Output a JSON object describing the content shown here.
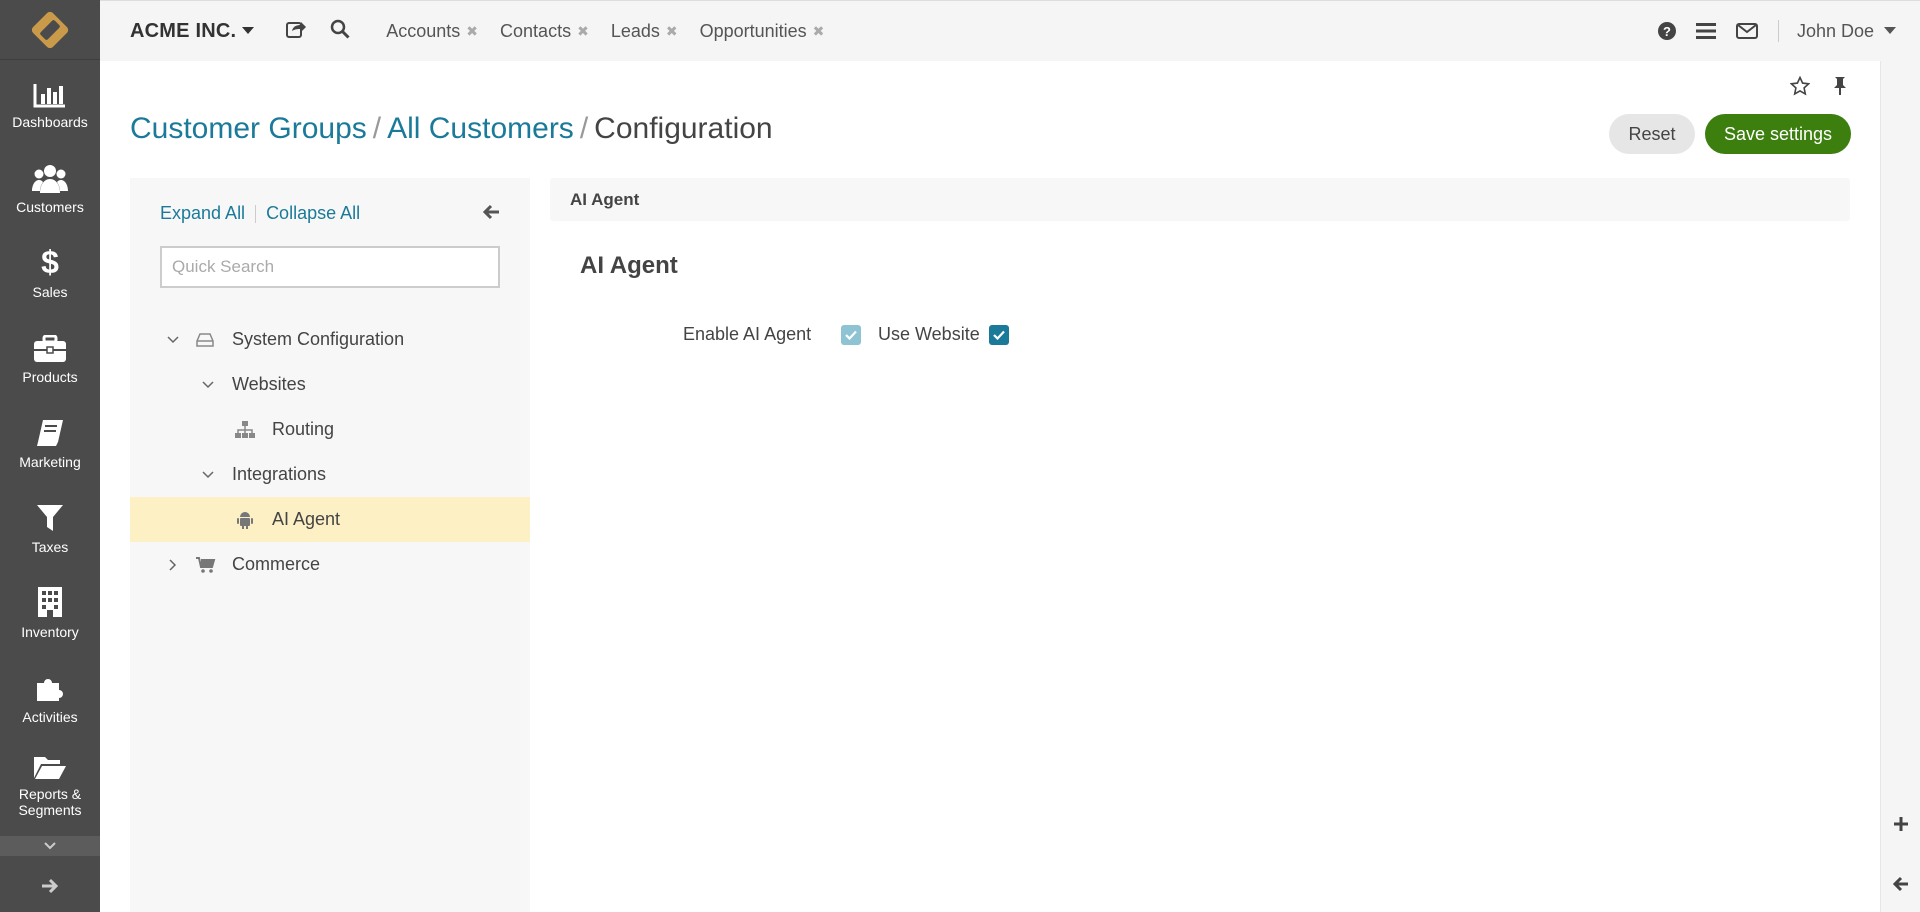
{
  "app": {
    "org_name": "ACME INC.",
    "user_name": "John Doe"
  },
  "nav": {
    "items": [
      {
        "label": "Dashboards",
        "icon": "bar-chart-icon"
      },
      {
        "label": "Customers",
        "icon": "users-icon"
      },
      {
        "label": "Sales",
        "icon": "dollar-icon"
      },
      {
        "label": "Products",
        "icon": "briefcase-icon"
      },
      {
        "label": "Marketing",
        "icon": "book-icon"
      },
      {
        "label": "Taxes",
        "icon": "filter-icon"
      },
      {
        "label": "Inventory",
        "icon": "building-icon"
      },
      {
        "label": "Activities",
        "icon": "puzzle-icon"
      },
      {
        "label": "Reports & Segments",
        "icon": "folder-icon"
      }
    ]
  },
  "tabs": [
    {
      "label": "Accounts"
    },
    {
      "label": "Contacts"
    },
    {
      "label": "Leads"
    },
    {
      "label": "Opportunities"
    }
  ],
  "page": {
    "breadcrumb": [
      "Customer Groups",
      "All Customers",
      "Configuration"
    ],
    "separator": "/",
    "reset_label": "Reset",
    "save_label": "Save settings"
  },
  "tree_panel": {
    "expand_all": "Expand All",
    "collapse_all": "Collapse All",
    "search_placeholder": "Quick Search",
    "nodes": [
      {
        "label": "System Configuration",
        "level": 0,
        "expanded": true,
        "icon": "hdd-icon"
      },
      {
        "label": "Websites",
        "level": 1,
        "expanded": true
      },
      {
        "label": "Routing",
        "level": 2,
        "icon": "sitemap-icon"
      },
      {
        "label": "Integrations",
        "level": 1,
        "expanded": true
      },
      {
        "label": "AI Agent",
        "level": 2,
        "icon": "android-icon",
        "active": true
      },
      {
        "label": "Commerce",
        "level": 0,
        "expanded": false,
        "icon": "cart-icon"
      }
    ]
  },
  "content": {
    "section_bar": "AI Agent",
    "section_title": "AI Agent",
    "fields": [
      {
        "label": "Enable AI Agent",
        "checked": true,
        "style": "use-default"
      },
      {
        "label": "Use Website",
        "checked": true,
        "style": "checkbox"
      }
    ]
  },
  "colors": {
    "nav_bg": "#4b4b4b",
    "link": "#1b7a99",
    "save_button": "#3c7f0f",
    "active_node": "#fdf0c4"
  }
}
